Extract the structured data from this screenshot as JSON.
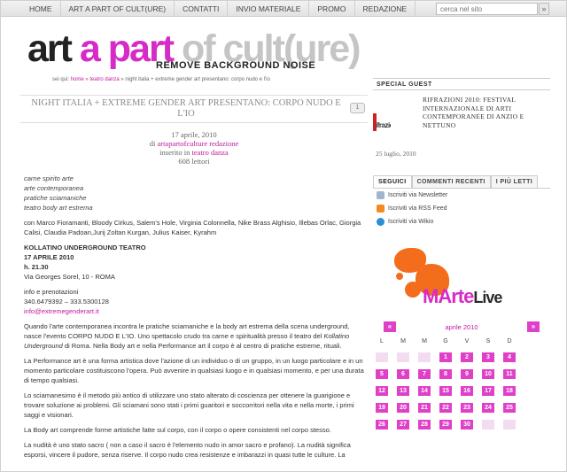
{
  "nav": {
    "items": [
      "HOME",
      "ART A PART OF CULT(URE)",
      "CONTATTI",
      "INVIO MATERIALE",
      "PROMO",
      "REDAZIONE"
    ]
  },
  "search": {
    "placeholder": "cerca nel sito",
    "button": "»"
  },
  "logo": {
    "part1": "art ",
    "part2": "a part ",
    "part3": "of cult(ure)",
    "tagline": "REMOVE BACKGROUND NOISE"
  },
  "breadcrumb": {
    "prefix": "sei qui: ",
    "home": "home",
    "sep": " » ",
    "cat": "teatro danza",
    "current": "night italia + extreme gender art presentano: corpo nudo e l'io"
  },
  "post": {
    "title": "NIGHT ITALIA + EXTREME GENDER ART PRESENTANO: CORPO NUDO E L'IO",
    "comments_icon": "1",
    "date": "17 aprile, 2010",
    "by_prefix": "di ",
    "author": "artapartofculture redazione",
    "in_prefix": "inserito in ",
    "category": "teatro danza",
    "readers": "608 lettori",
    "cats": [
      "carne spirito arte",
      "arte contemporanea",
      "pratiche sciamaniche",
      "teatro  body art estrema"
    ],
    "cast": "con  Marco Fioramanti, Bloody Cirkus, Salem's Hole, Virginia Colonnella, Nike Brass Alghisio, Illebas Orlac, Giorgia Calisi, Claudia Padoan,Jurij Zoltan Kurgan, Julius Kaiser, Kyrahm",
    "venue": "KOLLATINO UNDERGROUND TEATRO",
    "date2": "17 APRILE 2010",
    "time": "h. 21.30",
    "address": "Via Georges Sorel, 10 -  ROMA",
    "info": "info e prenotazioni",
    "phone": "340.6479392 – 333.5300128",
    "email": "info@extremegenderart.it",
    "p1a": "Quando l'arte contemporanea incontra le pratiche sciamaniche e la body art estrema della scena underground, nasce l'evento CORPO NUDO E L'IO. Uno spettacolo crudo tra carne e spiritualità presso il teatro del ",
    "p1b": "Kollatino Underground",
    "p1c": " di Roma. Nella Body art e nella Performance art il corpo è al centro di pratiche estreme, rituali.",
    "p2": "La Performance art è una forma artistica dove l'azione di un individuo o di un gruppo, in un luogo particolare e in un momento particolare costituiscono l'opera. Può avvenire in qualsiasi luogo e in qualsiasi momento, e per una durata di tempo qualsiasi.",
    "p3": "Lo sciamanesimo è il metodo più antico di utilizzare uno stato alterato di coscienza per ottenere la guarigione e trovare soluzione ai problemi. Gli sciamani  sono stati i primi guaritori e soccorritori nella vita e nella morte, i primi saggi e visionari.",
    "p4": "La Body art comprende forme artistiche fatte sul corpo, con il corpo o opere consistenti nel corpo stesso.",
    "p5": "La nudità è uno stato sacro ( non a caso il sacro è l'elemento nudo in amor sacro e profano). La nudità significa esporsi, vincere il pudore, senza riserve. Il corpo nudo crea resistenze e imbarazzi in quasi tutte le culture. La"
  },
  "sidebar": {
    "special_guest": {
      "heading": "SPECIAL GUEST",
      "title": "RIFRAZIONI 2010: FESTIVAL INTERNAZIONALE DI ARTI CONTEMPORANEE DI ANZIO E NETTUNO",
      "img_text": "ifrazic",
      "date": "25 luglio, 2010"
    },
    "tabs": [
      "SEGUICI",
      "COMMENTI RECENTI",
      "I PIÙ LETTI"
    ],
    "follow": [
      "Iscriviti via Newsletter",
      "Iscriviti via RSS Feed",
      "Iscriviti via Wikio"
    ],
    "marte": {
      "m": "M",
      "arte": "Arte",
      "live": "Live"
    },
    "calendar": {
      "month": "aprile 2010",
      "prev": "«",
      "next": "»",
      "days": [
        "L",
        "M",
        "M",
        "G",
        "V",
        "S",
        "D"
      ],
      "weeks": [
        [
          "",
          "",
          "",
          "1",
          "2",
          "3",
          "4"
        ],
        [
          "5",
          "6",
          "7",
          "8",
          "9",
          "10",
          "11"
        ],
        [
          "12",
          "13",
          "14",
          "15",
          "16",
          "17",
          "18"
        ],
        [
          "19",
          "20",
          "21",
          "22",
          "23",
          "24",
          "25"
        ],
        [
          "26",
          "27",
          "28",
          "29",
          "30",
          "",
          ""
        ]
      ]
    }
  }
}
